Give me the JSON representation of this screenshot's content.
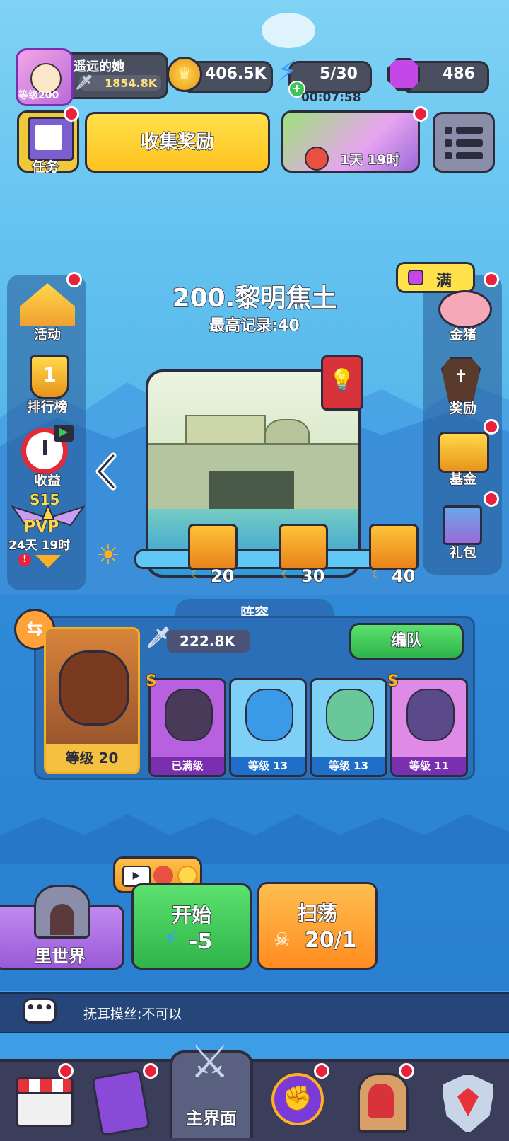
{
  "player": {
    "name": "遥远的她",
    "level_label": "等级200",
    "power": "1854.8K"
  },
  "resources": {
    "gold": "406.5K",
    "energy": "5/30",
    "energy_timer": "00:07:58",
    "gems": "486"
  },
  "top_buttons": {
    "task_label": "任务",
    "collect_label": "收集奖励",
    "event_timer": "1天 19时"
  },
  "left_menu": [
    {
      "label": "活动",
      "icon": "carnival-tent-icon"
    },
    {
      "label": "排行榜",
      "icon": "trophy-rank-icon"
    },
    {
      "label": "收益",
      "icon": "stopwatch-icon"
    },
    {
      "label": "24天 19时",
      "icon": "pvp-wings-icon",
      "season": "S15",
      "badge": "PVP"
    }
  ],
  "right_menu": [
    {
      "label": "金猪",
      "icon": "piggy-bank-icon",
      "bubble": "满"
    },
    {
      "label": "奖励",
      "icon": "coffin-icon"
    },
    {
      "label": "基金",
      "icon": "fund-chart-icon"
    },
    {
      "label": "礼包",
      "icon": "gift-box-icon"
    }
  ],
  "stage": {
    "title": "200.黎明焦土",
    "record": "最高记录:40",
    "milestones": [
      "20",
      "30",
      "40"
    ]
  },
  "lineup": {
    "title": "阵容",
    "power": "222.8K",
    "edit_label": "编队",
    "leader_level": "等级 20",
    "heroes": [
      {
        "rank": "S",
        "level": "已满级",
        "color": "#b760e0"
      },
      {
        "rank": "",
        "level": "等级 13",
        "color": "#38a4ee"
      },
      {
        "rank": "",
        "level": "等级 13",
        "color": "#38a4ee"
      },
      {
        "rank": "S",
        "level": "等级 11",
        "color": "#b760e0"
      }
    ]
  },
  "actions": {
    "underworld_label": "里世界",
    "start_label": "开始",
    "start_cost": "-5",
    "sweep_label": "扫荡",
    "sweep_count": "20/1"
  },
  "chat": {
    "message": "抚耳摸丝:不可以"
  },
  "bottom_nav": {
    "main_label": "主界面",
    "tabs": [
      "shop-icon",
      "cards-icon",
      "main-swords-icon",
      "fist-icon",
      "throne-icon",
      "shield-icon"
    ]
  },
  "colors": {
    "green": "#3fc45a",
    "orange": "#ffa23a",
    "purple": "#a86be8",
    "yellow": "#ffd23a"
  }
}
